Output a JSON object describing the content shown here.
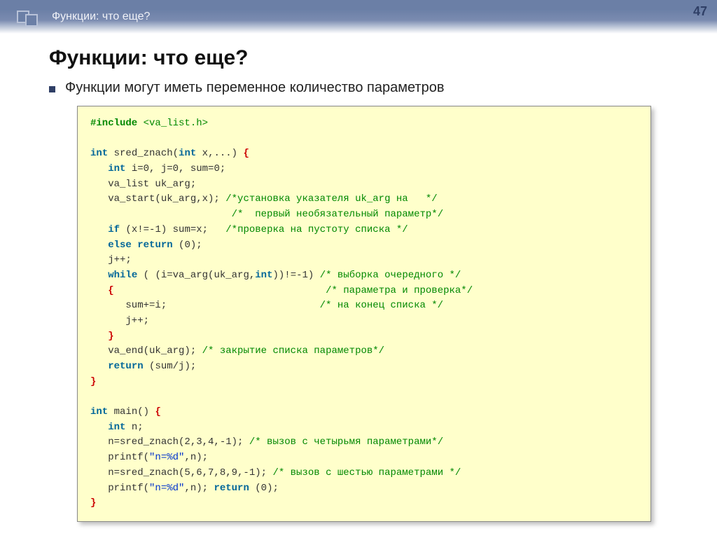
{
  "header": {
    "breadcrumb": "Функции: что еще?",
    "page": "47"
  },
  "title": "Функции: что еще?",
  "bullet1": "Функции могут иметь переменное количество параметров",
  "code": {
    "l01a": "#include",
    "l01b": " <va_list.h>",
    "l02": " ",
    "l03a": "int",
    "l03b": " sred_znach(",
    "l03c": "int",
    "l03d": " x,...) ",
    "l03e": "{",
    "l04a": "   ",
    "l04b": "int",
    "l04c": " i=0, j=0, sum=0;",
    "l05": "   va_list uk_arg;",
    "l06a": "   va_start(uk_arg,x); ",
    "l06b": "/*установка указателя uk_arg на   */",
    "l07a": "                        ",
    "l07b": "/*  первый необязательный параметр*/",
    "l08a": "   ",
    "l08b": "if",
    "l08c": " (x!=-1) sum=x;   ",
    "l08d": "/*проверка на пустоту списка */",
    "l09a": "   ",
    "l09b": "else",
    "l09c": " ",
    "l09d": "return",
    "l09e": " (0);",
    "l10": "   j++;",
    "l11a": "   ",
    "l11b": "while",
    "l11c": " ( (i=va_arg(uk_arg,",
    "l11d": "int",
    "l11e": "))!=-1) ",
    "l11f": "/* выборка очередного */",
    "l12a": "   ",
    "l12b": "{",
    "l12c": "                                    ",
    "l12d": "/* параметра и проверка*/",
    "l13a": "      sum+=i;                          ",
    "l13b": "/* на конец списка */",
    "l14": "      j++;",
    "l15a": "   ",
    "l15b": "}",
    "l16a": "   va_end(uk_arg); ",
    "l16b": "/* закрытие списка параметров*/",
    "l17a": "   ",
    "l17b": "return",
    "l17c": " (sum/j);",
    "l18": "}",
    "l19": " ",
    "l20a": "int",
    "l20b": " main() ",
    "l20c": "{",
    "l21a": "   ",
    "l21b": "int",
    "l21c": " n;",
    "l22a": "   n=sred_znach(2,3,4,-1); ",
    "l22b": "/* вызов с четырьмя параметрами*/",
    "l23a": "   printf(",
    "l23b": "\"n=%d\"",
    "l23c": ",n);",
    "l24a": "   n=sred_znach(5,6,7,8,9,-1); ",
    "l24b": "/* вызов с шестью параметрами */",
    "l25a": "   printf(",
    "l25b": "\"n=%d\"",
    "l25c": ",n); ",
    "l25d": "return",
    "l25e": " (0);",
    "l26": "}"
  }
}
